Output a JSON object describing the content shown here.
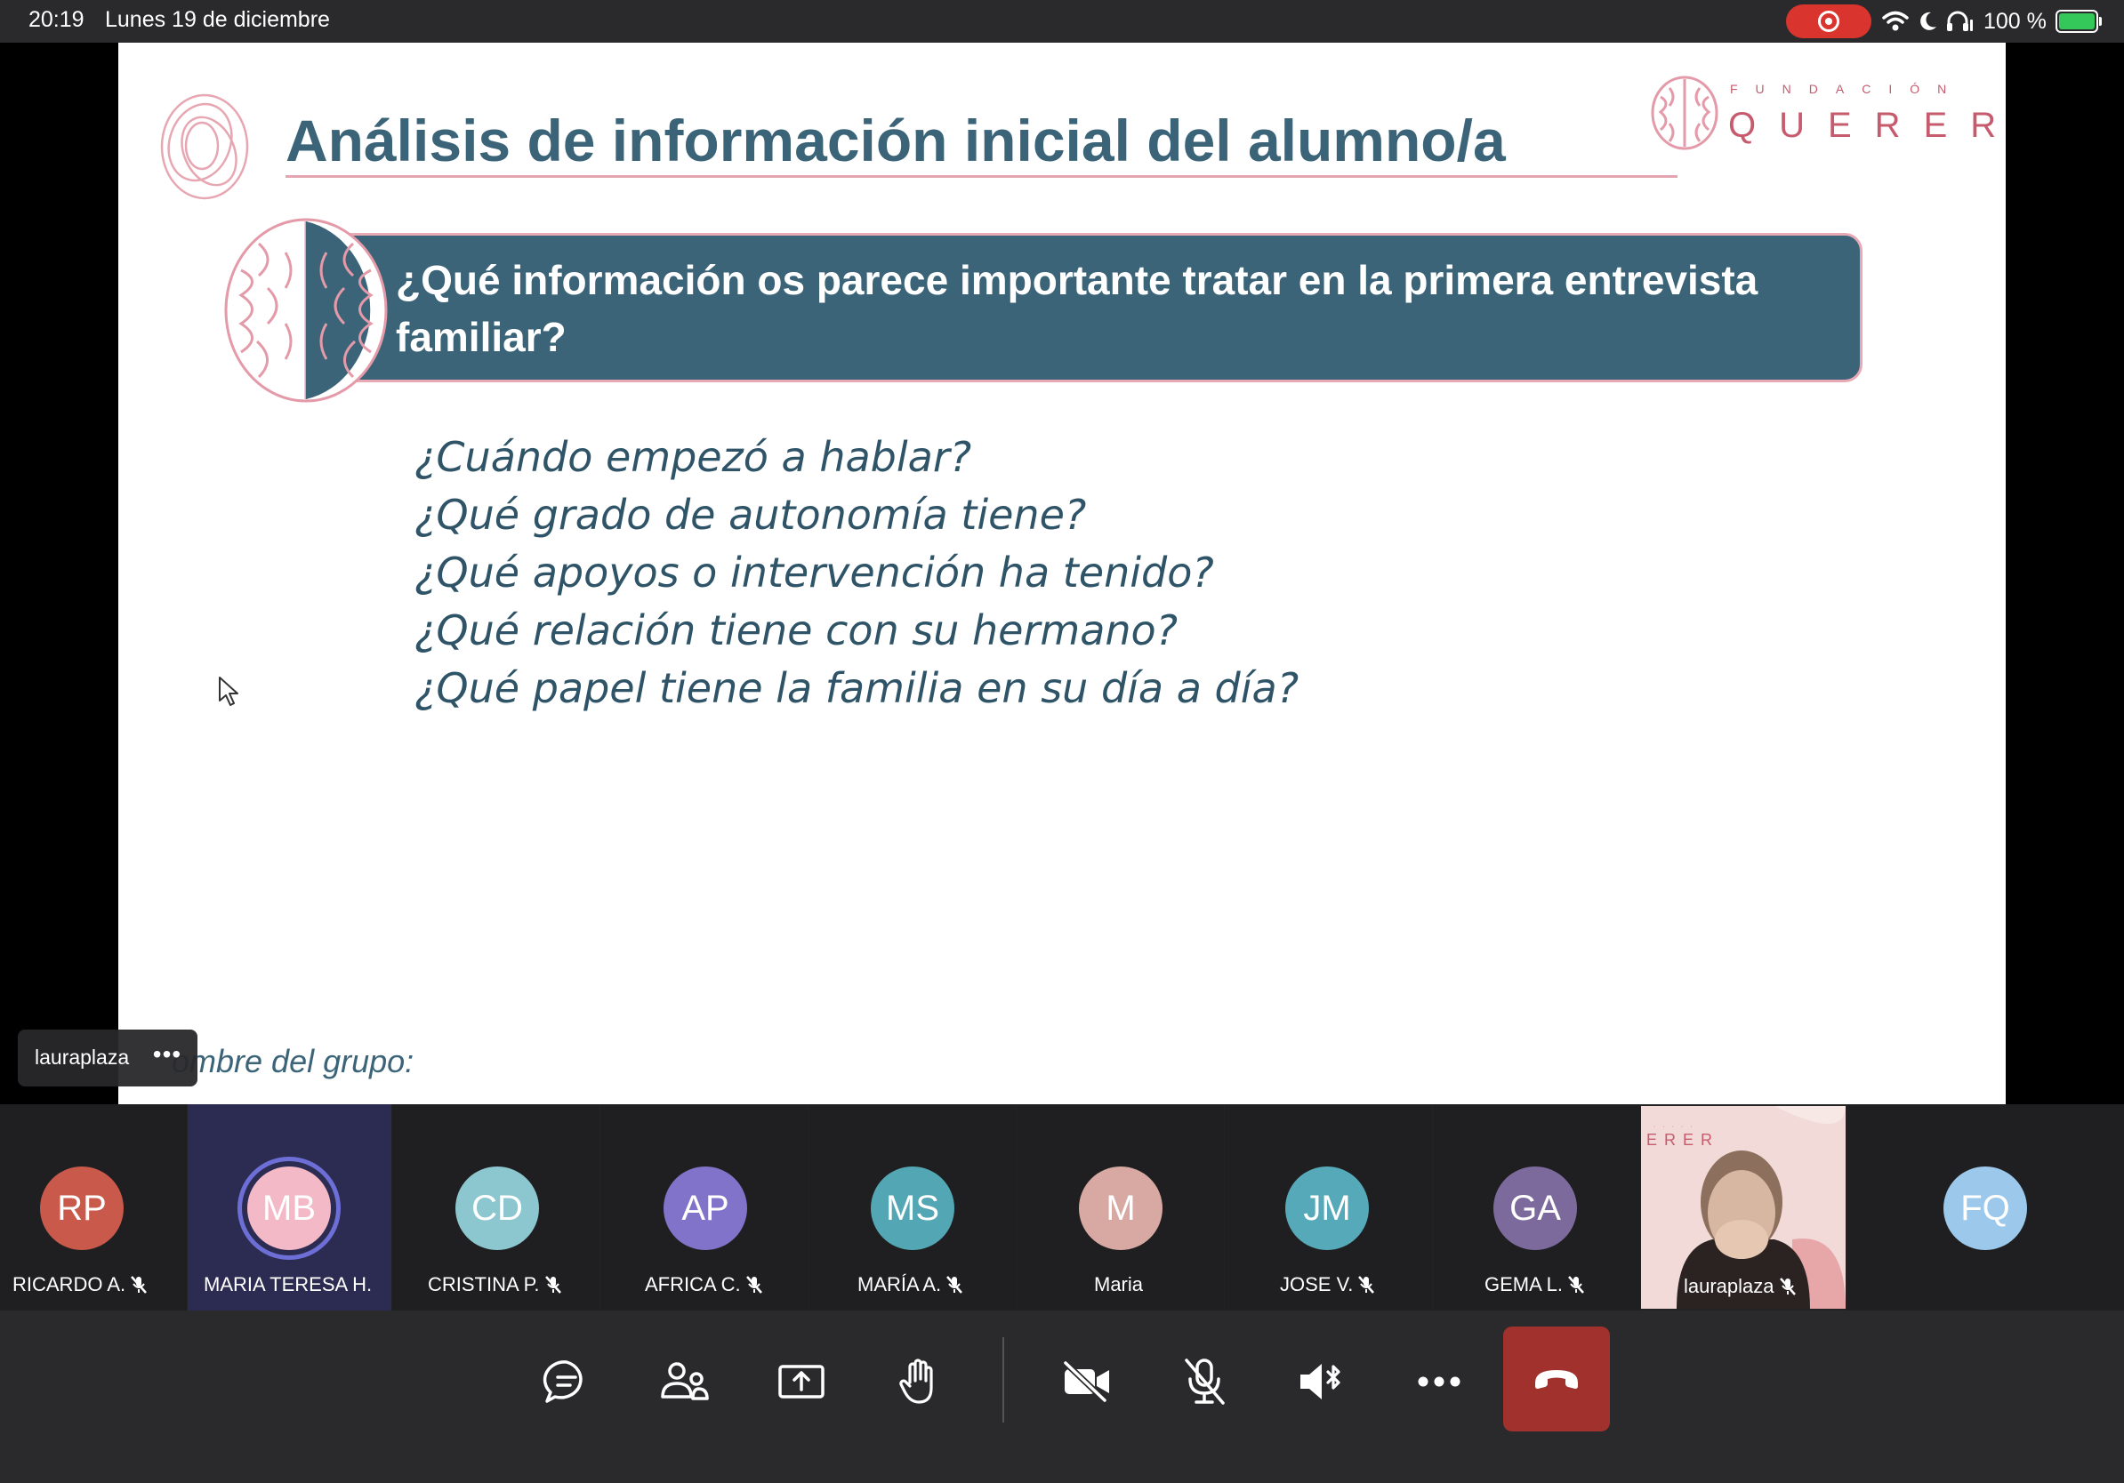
{
  "status_bar": {
    "time": "20:19",
    "date": "Lunes 19 de diciembre",
    "battery": "100 %",
    "icons": [
      "screen-record-icon",
      "wifi-icon",
      "moon-icon",
      "headphones-icon",
      "battery-charging-icon"
    ]
  },
  "slide": {
    "title": "Análisis de información inicial del alumno/a",
    "logo_top": "FUNDACIÓN",
    "logo_main": "QUERER",
    "question": "¿Qué información os parece importante tratar en la primera entrevista familiar?",
    "questions": [
      "¿Cuándo empezó a hablar?",
      "¿Qué grado de autonomía tiene?",
      "¿Qué apoyos o intervención ha tenido?",
      "¿Qué relación tiene con su hermano?",
      "¿Qué papel tiene la familia en su día a día?"
    ],
    "group_label": "ombre del grupo:"
  },
  "presenter_tag": {
    "name": "lauraplaza",
    "more": "•••"
  },
  "participants": [
    {
      "initials": "RP",
      "name": "RICARDO A.",
      "color": "#c9594a",
      "muted": true
    },
    {
      "initials": "MB",
      "name": "MARIA TERESA H.",
      "color": "#f3b9c7",
      "muted": false,
      "speaking": true
    },
    {
      "initials": "CD",
      "name": "CRISTINA P.",
      "color": "#8cc7cf",
      "muted": true
    },
    {
      "initials": "AP",
      "name": "AFRICA C.",
      "color": "#8173c9",
      "muted": true
    },
    {
      "initials": "MS",
      "name": "MARÍA A.",
      "color": "#53a6b3",
      "muted": true
    },
    {
      "initials": "M",
      "name": "Maria",
      "color": "#d8a9a3",
      "muted": false
    },
    {
      "initials": "JM",
      "name": "JOSE V.",
      "color": "#56a9b9",
      "muted": true
    },
    {
      "initials": "GA",
      "name": "GEMA L.",
      "color": "#7c6a9d",
      "muted": true
    },
    {
      "initials": "",
      "name": "lauraplaza",
      "video": true,
      "muted": true
    },
    {
      "initials": "FQ",
      "name": "",
      "color": "#9cc8ec",
      "muted": false
    }
  ],
  "video_tile_logo": "ERER",
  "toolbar": {
    "buttons": [
      "chat-icon",
      "participants-icon",
      "share-screen-icon",
      "raise-hand-icon",
      "camera-off-icon",
      "mic-off-icon",
      "speaker-bluetooth-icon",
      "more-icon",
      "hang-up-icon"
    ],
    "accent_hangup": "#a0312d"
  },
  "colors": {
    "slide_title": "#3c6479",
    "brand_pink": "#c75b6e",
    "speaking_ring": "#6d6fd6"
  }
}
